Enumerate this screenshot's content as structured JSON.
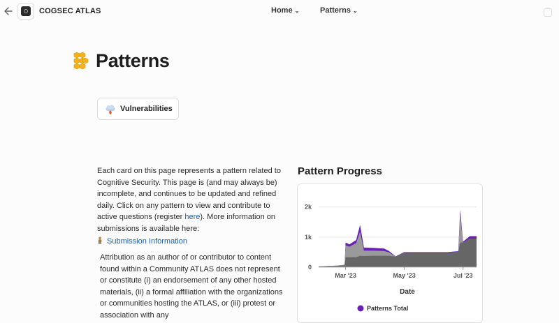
{
  "header": {
    "brand": "COGSEC ATLAS",
    "back_icon": "back-arrow-icon",
    "nav": [
      {
        "label": "Home"
      },
      {
        "label": "Patterns"
      }
    ]
  },
  "page": {
    "title": "Patterns",
    "title_icon": "honeycomb-icon"
  },
  "cards": [
    {
      "label": "Vulnerabilities",
      "icon": "cloud-flame-icon"
    }
  ],
  "description": {
    "text1": "Each card on this page represents a pattern related to Cognitive Security. This page is (and may always be) incomplete, and continues to be updated and refined daily. Click on any pattern to view and contribute to active questions (register ",
    "here_link": "here",
    "text2": "). More information on submissions is available here:",
    "submission_link": "Submission Information"
  },
  "attribution": "Attribution as an author of or contributor to content found within a Community ATLAS does not represent or constitute (i) an endorsement of any other hosted materials, (ii) a formal affiliation with the organizations or communities hosting the ATLAS, or (iii) protest or association with any",
  "chart_data": {
    "type": "area",
    "title": "Pattern Progress",
    "xlabel": "Date",
    "ylabel": "",
    "ylim": [
      0,
      2200
    ],
    "y_ticks": [
      "0",
      "1k",
      "2k"
    ],
    "x_ticks": [
      "Mar '23",
      "May '23",
      "Jul '23"
    ],
    "legend": [
      "Patterns Total"
    ],
    "colors": {
      "total": "#6a1fb8",
      "grey": "#9a9a9a",
      "dark": "#666666"
    },
    "x": [
      "2023-02-01",
      "2023-02-20",
      "2023-02-28",
      "2023-03-01",
      "2023-03-05",
      "2023-03-12",
      "2023-03-16",
      "2023-03-20",
      "2023-03-30",
      "2023-04-10",
      "2023-04-15",
      "2023-04-22",
      "2023-05-01",
      "2023-05-20",
      "2023-06-01",
      "2023-06-15",
      "2023-06-22",
      "2023-06-26",
      "2023-06-28",
      "2023-07-01",
      "2023-07-03",
      "2023-07-08",
      "2023-07-15"
    ],
    "series": [
      {
        "name": "Patterns Total",
        "values": [
          30,
          50,
          80,
          820,
          760,
          900,
          1400,
          650,
          640,
          620,
          540,
          360,
          500,
          500,
          500,
          500,
          520,
          530,
          1900,
          850,
          900,
          1030,
          1030
        ]
      },
      {
        "name": "",
        "values": [
          30,
          50,
          80,
          720,
          680,
          800,
          1180,
          550,
          550,
          540,
          490,
          350,
          480,
          480,
          480,
          480,
          500,
          510,
          1750,
          800,
          850,
          950,
          950
        ]
      },
      {
        "name": "",
        "values": [
          20,
          40,
          60,
          330,
          330,
          330,
          380,
          370,
          380,
          380,
          380,
          350,
          480,
          480,
          480,
          480,
          500,
          510,
          820,
          820,
          850,
          950,
          950
        ]
      }
    ]
  }
}
